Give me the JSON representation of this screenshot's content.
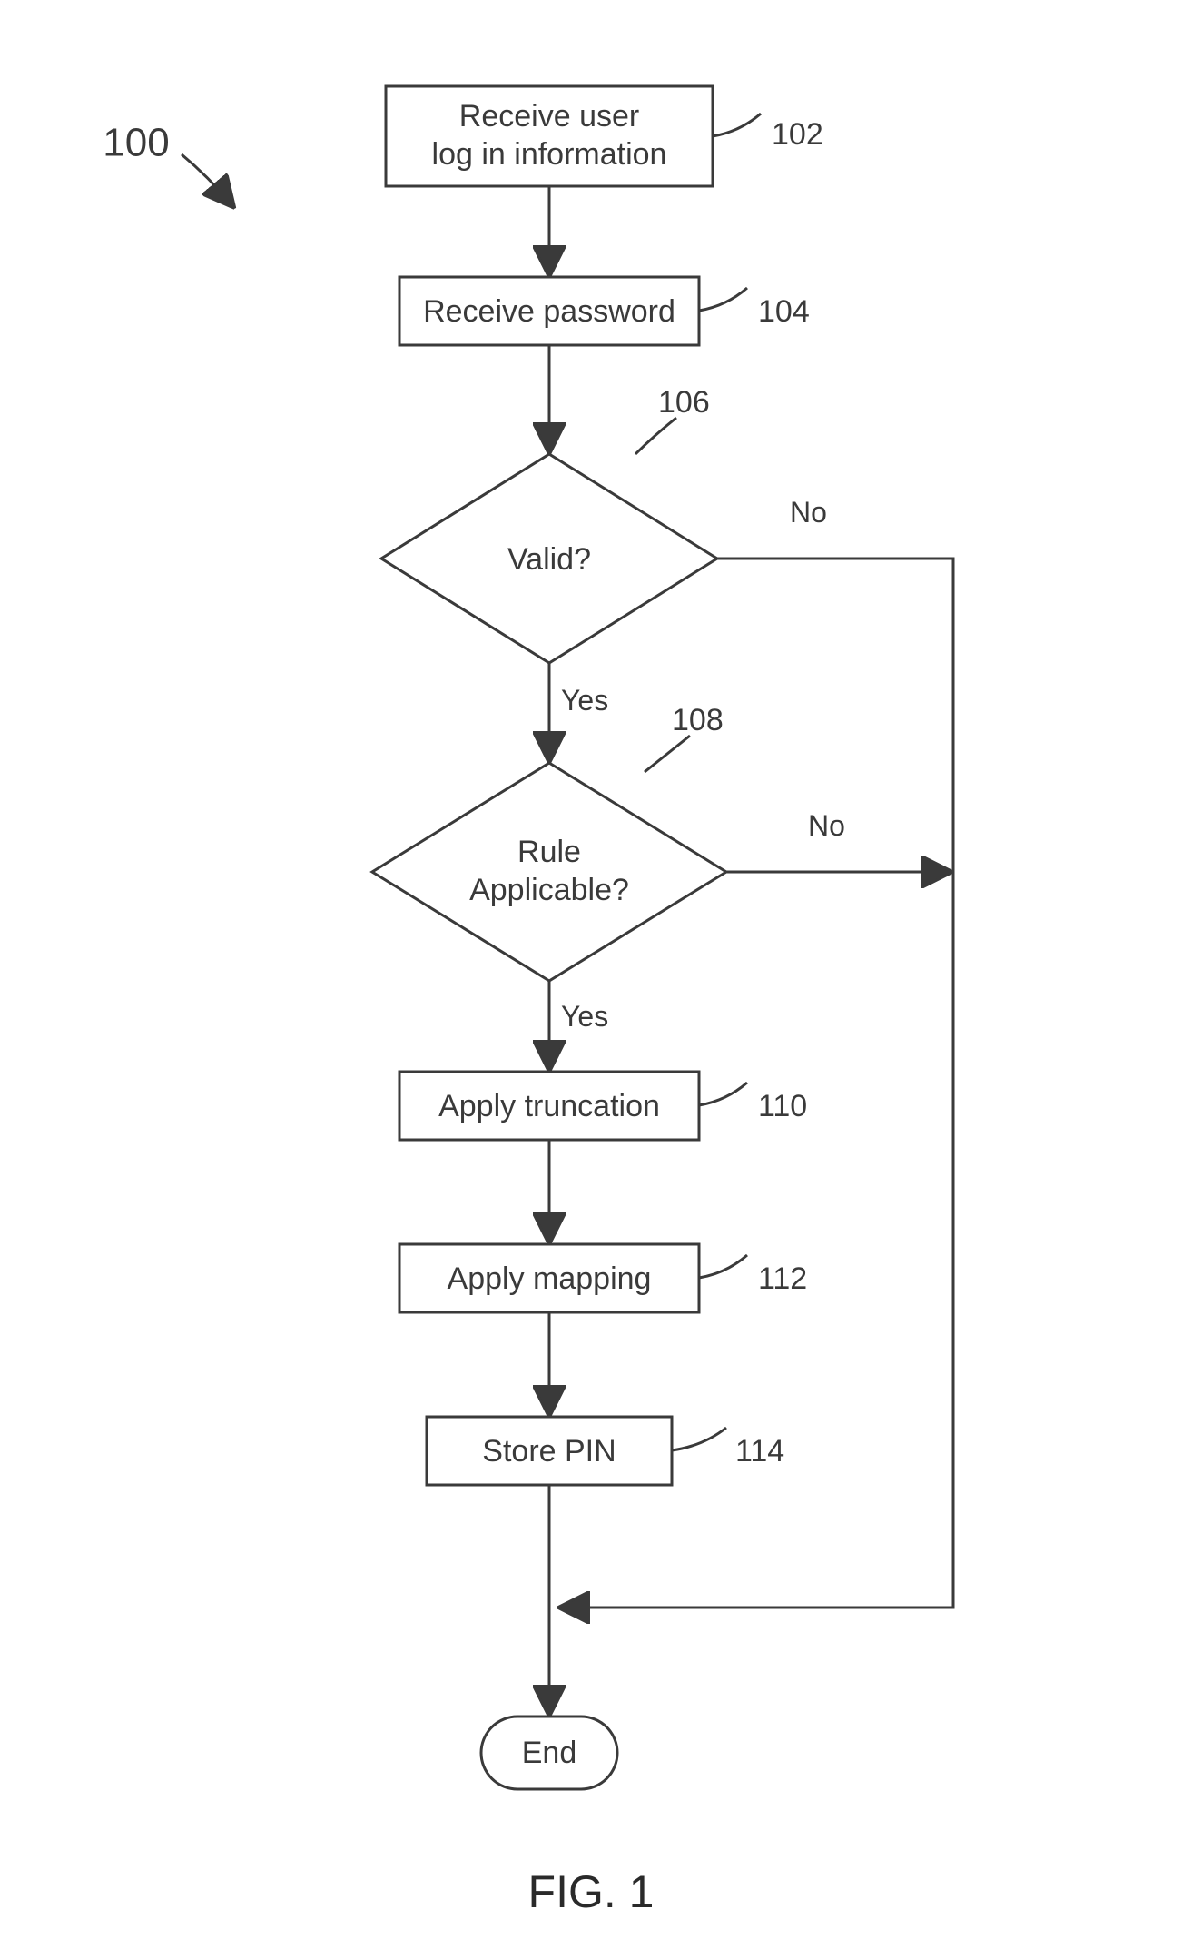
{
  "title": "100",
  "figure_label": "FIG. 1",
  "nodes": {
    "n102": {
      "text1": "Receive user",
      "text2": "log in information",
      "ref": "102"
    },
    "n104": {
      "text1": "Receive password",
      "ref": "104"
    },
    "n106": {
      "text1": "Valid?",
      "ref": "106"
    },
    "n108": {
      "text1": "Rule",
      "text2": "Applicable?",
      "ref": "108"
    },
    "n110": {
      "text1": "Apply truncation",
      "ref": "110"
    },
    "n112": {
      "text1": "Apply mapping",
      "ref": "112"
    },
    "n114": {
      "text1": "Store PIN",
      "ref": "114"
    },
    "end": {
      "text1": "End"
    }
  },
  "edges": {
    "yes": "Yes",
    "no": "No"
  }
}
